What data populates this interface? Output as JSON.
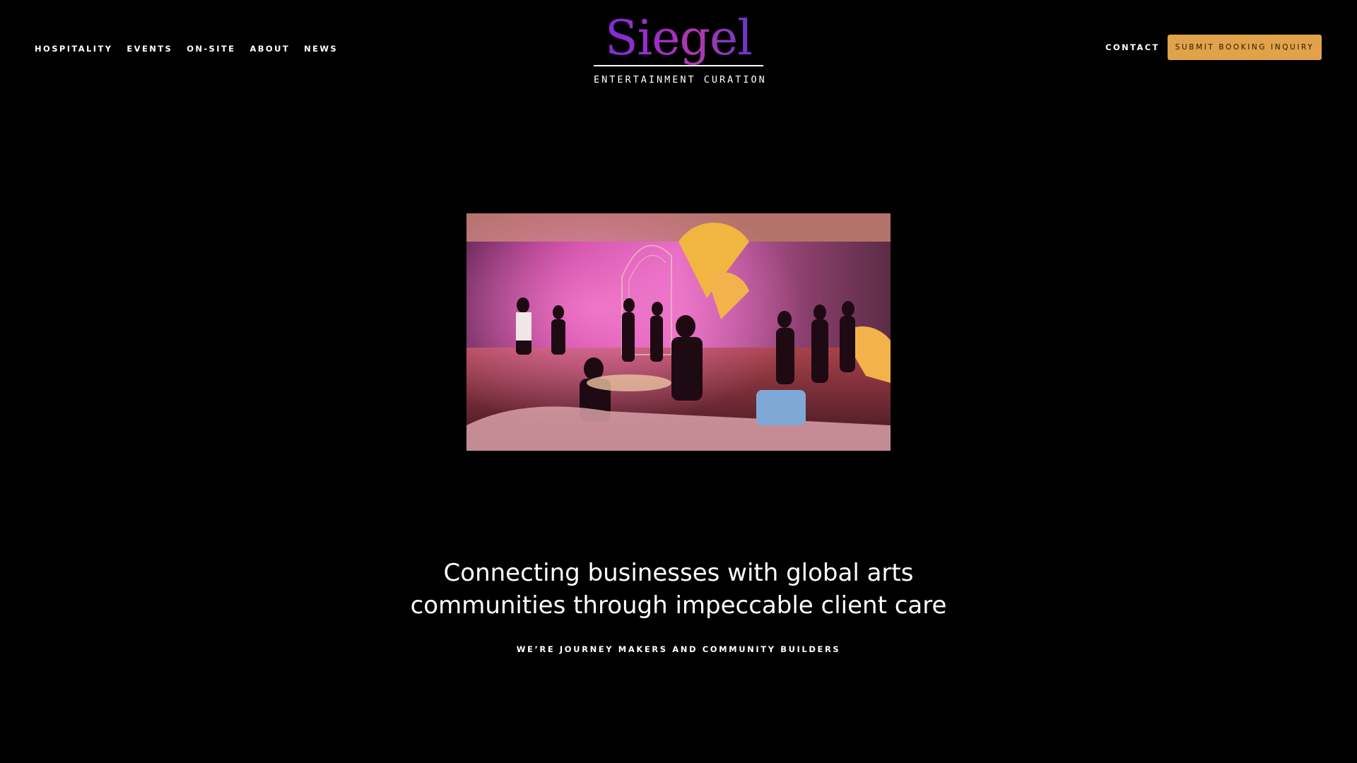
{
  "nav": {
    "items": [
      {
        "label": "HOSPITALITY"
      },
      {
        "label": "EVENTS"
      },
      {
        "label": "ON-SITE"
      },
      {
        "label": "ABOUT"
      },
      {
        "label": "NEWS"
      }
    ],
    "contact_label": "CONTACT",
    "booking_label": "SUBMIT BOOKING INQUIRY"
  },
  "logo": {
    "wordmark": "Siegel",
    "subtitle": "ENTERTAINMENT CURATION"
  },
  "hero": {
    "headline_line1": "Connecting businesses with global arts",
    "headline_line2": "communities through impeccable client care",
    "tagline": "WE’RE JOURNEY MAKERS AND COMMUNITY BUILDERS"
  },
  "colors": {
    "background": "#000000",
    "accent_button": "#e0a24a",
    "logo_gradient_start": "#7a2bd6",
    "logo_gradient_end": "#5b34d0"
  }
}
